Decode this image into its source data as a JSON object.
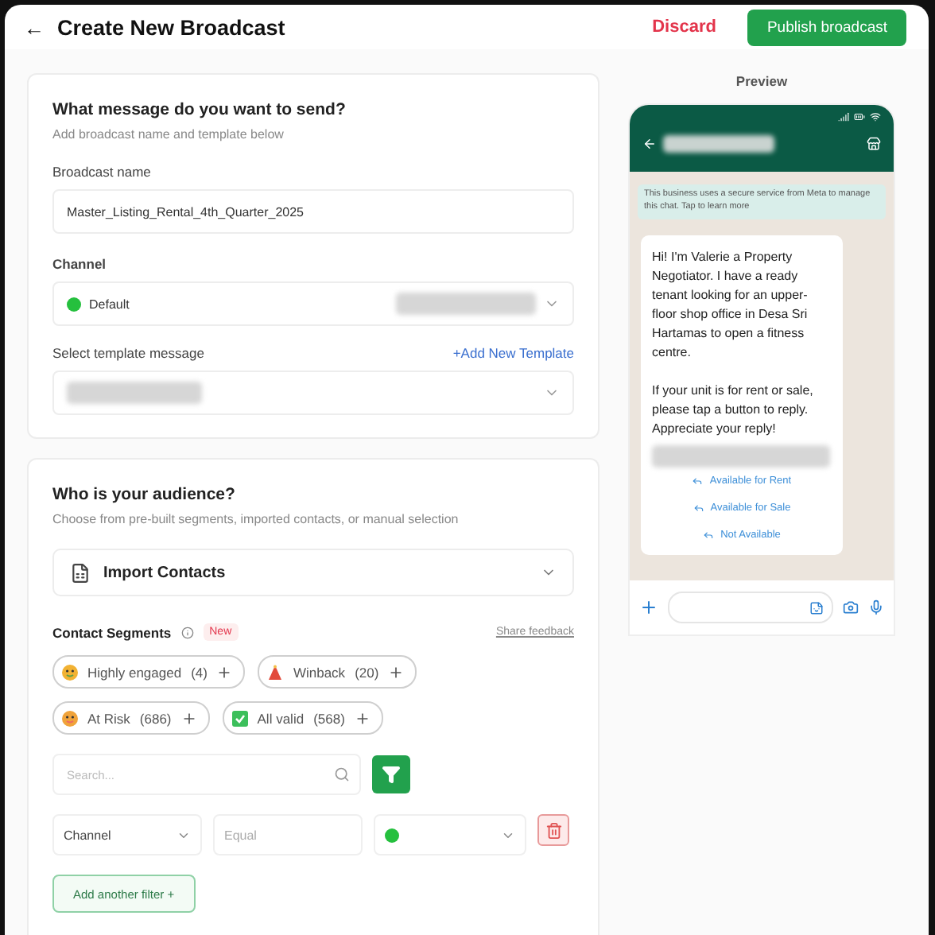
{
  "header": {
    "back": "←",
    "title": "Create New Broadcast",
    "discard": "Discard",
    "publish": "Publish broadcast"
  },
  "message_card": {
    "title": "What message do you want to send?",
    "subtitle": "Add broadcast name and template below",
    "name_label": "Broadcast name",
    "name_value": "Master_Listing_Rental_4th_Quarter_2025",
    "channel_label": "Channel",
    "channel_value": "Default",
    "template_label": "Select template message",
    "template_link": "+Add New Template"
  },
  "audience_card": {
    "title": "Who is your audience?",
    "subtitle": "Choose from pre-built segments, imported contacts, or manual selection",
    "import": "Import Contacts",
    "segments_label": "Contact Segments",
    "new_badge": "New",
    "feedback": "Share feedback",
    "segments": [
      {
        "kind": "engaged",
        "label": "Highly engaged",
        "count": "(4)"
      },
      {
        "kind": "winback",
        "label": "Winback",
        "count": "(20)"
      },
      {
        "kind": "risk",
        "label": "At Risk",
        "count": "(686)"
      },
      {
        "kind": "valid",
        "label": "All valid",
        "count": "(568)"
      }
    ],
    "search": {
      "placeholder": "Search..."
    },
    "filter": {
      "field": "Channel",
      "operator": "Equal"
    },
    "add_filter": "Add another filter +"
  },
  "preview": {
    "title": "Preview",
    "notice": "This business uses a secure service from Meta to manage this chat. Tap to learn more",
    "message": "Hi! I'm Valerie a Property Negotiator. I have a ready tenant looking for an upper-floor shop office in Desa Sri Hartamas to open a fitness centre.\n\nIf your unit is for rent or sale, please tap a button to reply. Appreciate your reply!",
    "replies": [
      "Available for Rent",
      "Available for Sale",
      "Not Available"
    ]
  }
}
